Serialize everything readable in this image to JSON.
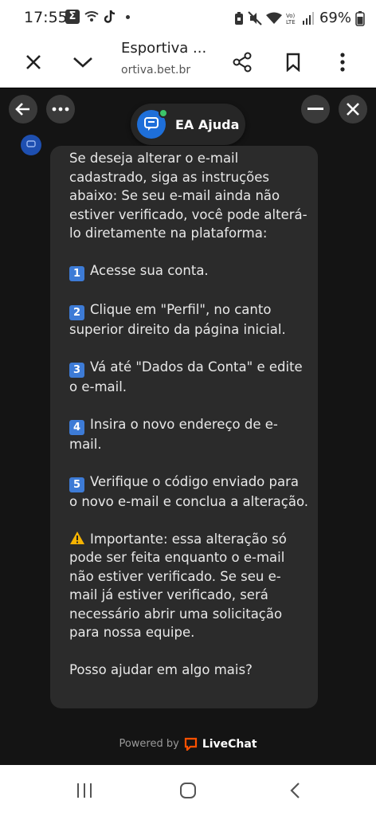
{
  "status_bar": {
    "time": "17:55",
    "battery_percent": "69%",
    "left_icons": [
      "sigma-app-icon",
      "wifi-call-icon",
      "tiktok-icon",
      "dot-icon"
    ],
    "right_icons": [
      "battery-saver-icon",
      "mute-icon",
      "wifi-icon",
      "volte-icon",
      "signal-icon"
    ]
  },
  "browser": {
    "title": "Esportiva ...",
    "url": "ortiva.bet.br",
    "buttons": [
      "close-icon",
      "chevron-down-icon",
      "share-icon",
      "bookmark-icon",
      "more-vert-icon"
    ]
  },
  "chat": {
    "agent_name": "EA Ajuda",
    "status_color": "#3cc46a",
    "accent_color": "#1e6fd9",
    "intro": "Se deseja alterar o e-mail cadastrado, siga as instruções abaixo: Se seu e-mail ainda não estiver verificado, você pode alterá-lo diretamente na plataforma:",
    "steps": [
      {
        "n": "1",
        "text": "Acesse sua conta."
      },
      {
        "n": "2",
        "text": "Clique em \"Perfil\", no canto superior direito da página inicial."
      },
      {
        "n": "3",
        "text": "Vá até \"Dados da Conta\" e edite o e-mail."
      },
      {
        "n": "4",
        "text": "Insira o novo endereço de e-mail."
      },
      {
        "n": "5",
        "text": "Verifique o código enviado para o novo e-mail e conclua a alteração."
      }
    ],
    "important": "Importante: essa alteração só pode ser feita enquanto o e-mail não estiver verificado. Se seu e-mail já estiver verificado, será necessário abrir uma solicitação para nossa equipe.",
    "closing": "Posso ajudar em algo mais?",
    "powered_by": "Powered by",
    "brand": "LiveChat",
    "brand_color": "#ff5100"
  },
  "nav": {
    "buttons": [
      "recents-icon",
      "home-icon",
      "back-icon"
    ]
  }
}
